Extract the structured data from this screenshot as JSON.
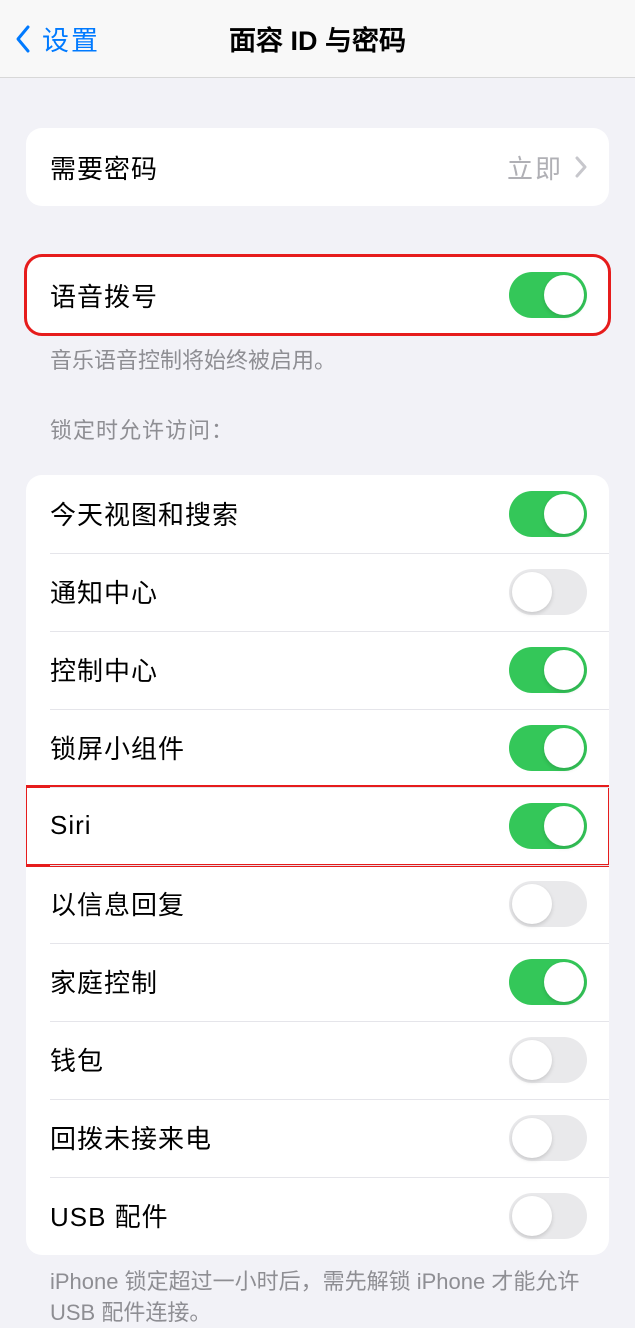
{
  "header": {
    "back_label": "设置",
    "title": "面容 ID 与密码"
  },
  "require_passcode": {
    "label": "需要密码",
    "value": "立即"
  },
  "voice_dial": {
    "label": "语音拨号",
    "on": true,
    "footer": "音乐语音控制将始终被启用。"
  },
  "allow_access_section": {
    "header": "锁定时允许访问：",
    "items": [
      {
        "label": "今天视图和搜索",
        "on": true,
        "highlight": false
      },
      {
        "label": "通知中心",
        "on": false,
        "highlight": false
      },
      {
        "label": "控制中心",
        "on": true,
        "highlight": false
      },
      {
        "label": "锁屏小组件",
        "on": true,
        "highlight": false
      },
      {
        "label": "Siri",
        "on": true,
        "highlight": true
      },
      {
        "label": "以信息回复",
        "on": false,
        "highlight": false
      },
      {
        "label": "家庭控制",
        "on": true,
        "highlight": false
      },
      {
        "label": "钱包",
        "on": false,
        "highlight": false
      },
      {
        "label": "回拨未接来电",
        "on": false,
        "highlight": false
      },
      {
        "label": "USB 配件",
        "on": false,
        "highlight": false
      }
    ],
    "footer": "iPhone 锁定超过一小时后，需先解锁 iPhone 才能允许 USB 配件连接。"
  }
}
